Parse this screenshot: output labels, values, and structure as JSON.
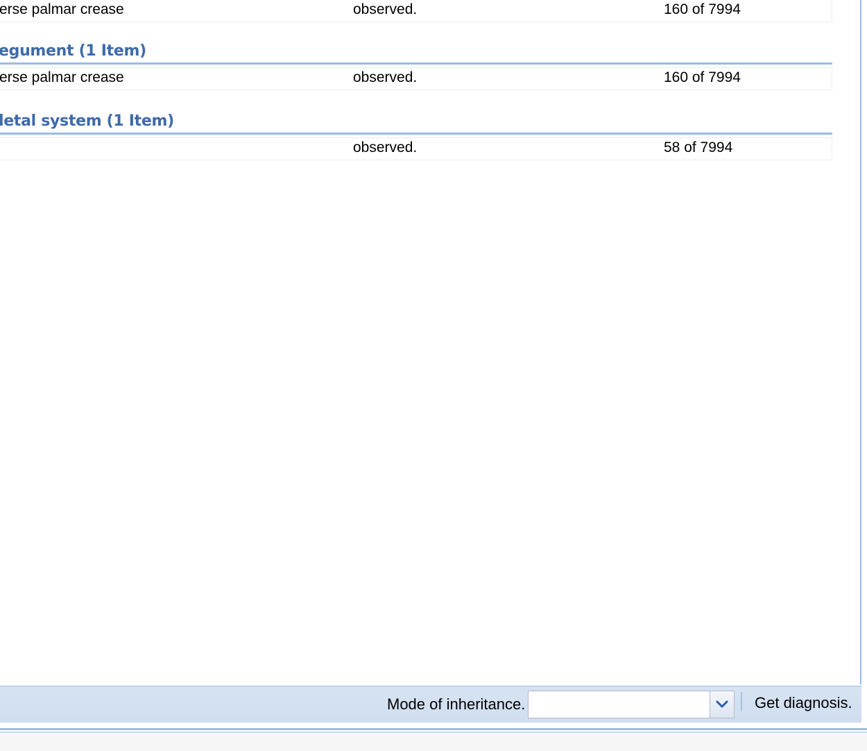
{
  "grid": {
    "row0": {
      "name": "erse palmar crease",
      "status": "observed.",
      "frequency": "160 of 7994"
    },
    "groups": [
      {
        "title": "egument (1 Item)",
        "rows": [
          {
            "name": "erse palmar crease",
            "status": "observed.",
            "frequency": "160 of 7994"
          }
        ]
      },
      {
        "title": "letal system (1 Item)",
        "rows": [
          {
            "name": "",
            "status": "observed.",
            "frequency": "58 of 7994"
          }
        ]
      }
    ]
  },
  "toolbar": {
    "mode_label": "Mode of inheritance.",
    "mode_value": "",
    "get_diagnosis_label": "Get diagnosis."
  },
  "icons": {
    "combo_trigger": "chevron-down-icon"
  },
  "colors": {
    "accent": "#99bbe8",
    "group_title": "#3e6aaa",
    "toolbar_bg": "#d6e3f2"
  }
}
